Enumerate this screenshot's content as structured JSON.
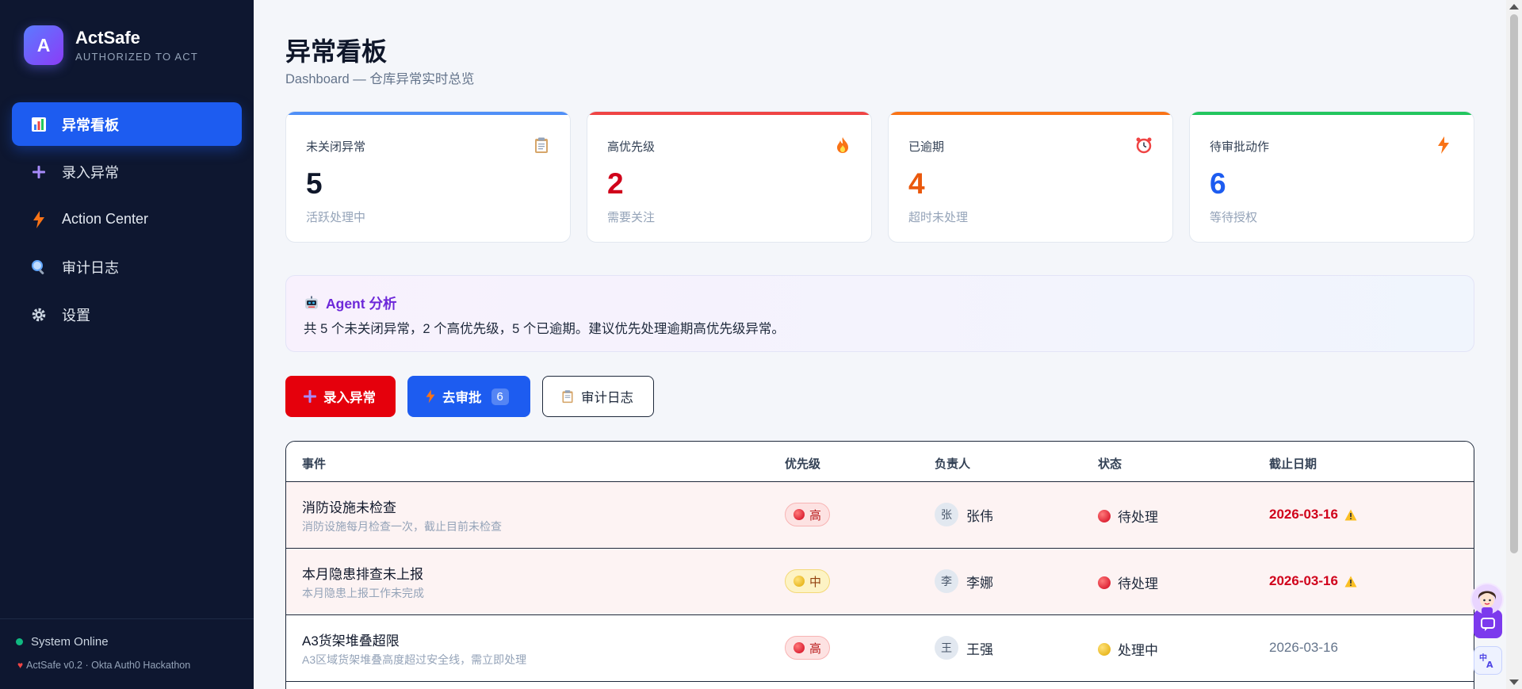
{
  "brand": {
    "logo_letter": "A",
    "name": "ActSafe",
    "tagline": "AUTHORIZED TO ACT"
  },
  "nav": [
    {
      "label": "异常看板",
      "icon": "bar-chart-icon",
      "active": true
    },
    {
      "label": "录入异常",
      "icon": "plus-icon",
      "active": false
    },
    {
      "label": "Action Center",
      "icon": "lightning-icon",
      "active": false
    },
    {
      "label": "审计日志",
      "icon": "magnifier-icon",
      "active": false
    },
    {
      "label": "设置",
      "icon": "gear-icon",
      "active": false
    }
  ],
  "footer": {
    "status": "System Online",
    "version": "ActSafe v0.2 · Okta Auth0 Hackathon"
  },
  "page": {
    "title": "异常看板",
    "subtitle": "Dashboard — 仓库异常实时总览"
  },
  "stats": [
    {
      "label": "未关闭异常",
      "value": "5",
      "hint": "活跃处理中",
      "icon": "clipboard-icon",
      "accent": "#4f8ff7",
      "value_color": "#0f172a"
    },
    {
      "label": "高优先级",
      "value": "2",
      "hint": "需要关注",
      "icon": "fire-icon",
      "accent": "#ef4444",
      "value_color": "#d0021b"
    },
    {
      "label": "已逾期",
      "value": "4",
      "hint": "超时未处理",
      "icon": "alarm-clock-icon",
      "accent": "#f97316",
      "value_color": "#ea580c"
    },
    {
      "label": "待审批动作",
      "value": "6",
      "hint": "等待授权",
      "icon": "lightning-icon",
      "accent": "#22c55e",
      "value_color": "#1d5cf0"
    }
  ],
  "agent": {
    "title": "Agent 分析",
    "text": "共 5 个未关闭异常，2 个高优先级，5 个已逾期。建议优先处理逾期高优先级异常。"
  },
  "actions": {
    "add_label": "录入异常",
    "approve_label": "去审批",
    "approve_count": "6",
    "audit_label": "审计日志"
  },
  "table": {
    "headers": {
      "event": "事件",
      "priority": "优先级",
      "owner": "负责人",
      "status": "状态",
      "due": "截止日期"
    },
    "rows": [
      {
        "title": "消防设施未检查",
        "desc": "消防设施每月检查一次，截止目前未检查",
        "priority": "高",
        "priority_level": "high",
        "owner_initial": "张",
        "owner": "张伟",
        "status": "待处理",
        "status_color": "red",
        "due": "2026-03-16",
        "overdue": true
      },
      {
        "title": "本月隐患排查未上报",
        "desc": "本月隐患上报工作未完成",
        "priority": "中",
        "priority_level": "mid",
        "owner_initial": "李",
        "owner": "李娜",
        "status": "待处理",
        "status_color": "red",
        "due": "2026-03-16",
        "overdue": true
      },
      {
        "title": "A3货架堆叠超限",
        "desc": "A3区域货架堆叠高度超过安全线，需立即处理",
        "priority": "高",
        "priority_level": "high",
        "owner_initial": "王",
        "owner": "王强",
        "status": "处理中",
        "status_color": "yellow",
        "due": "2026-03-16",
        "overdue": false
      }
    ]
  }
}
